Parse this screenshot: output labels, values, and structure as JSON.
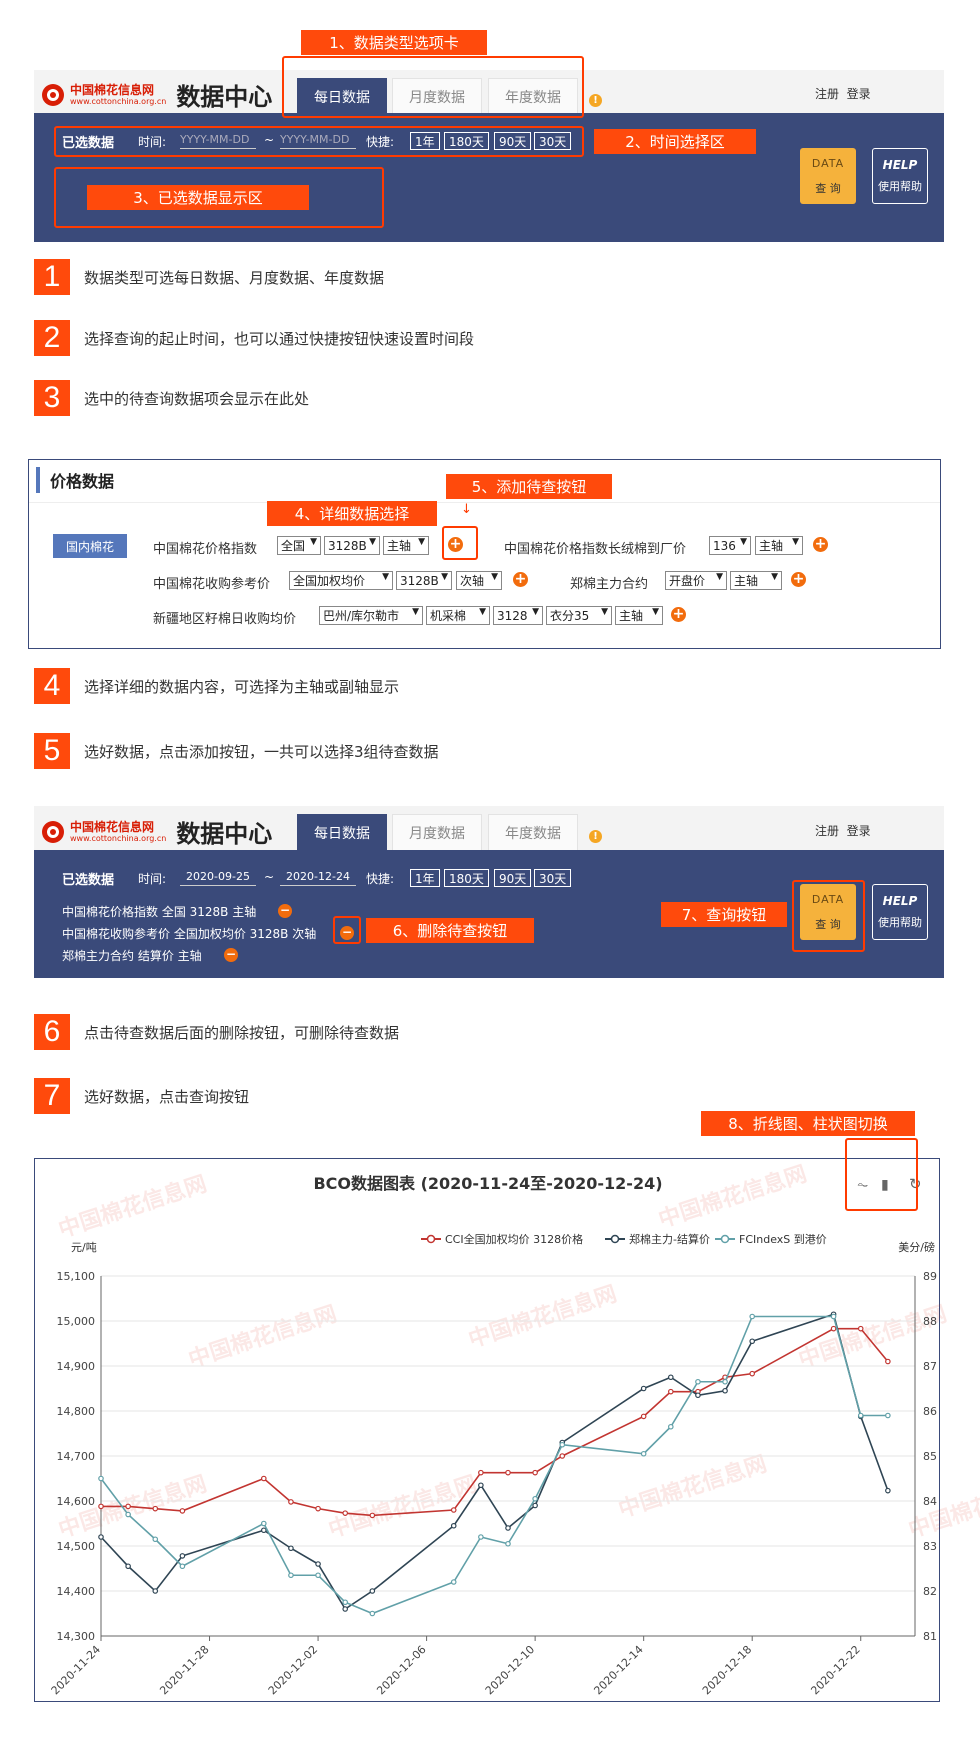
{
  "brand": {
    "name_cn": "中国棉花信息网",
    "url": "www.cottonchina.org.cn",
    "data_center": "数据中心"
  },
  "tabs": [
    "每日数据",
    "月度数据",
    "年度数据"
  ],
  "top_links": {
    "register": "注册",
    "login": "登录"
  },
  "filter": {
    "selected_label": "已选数据",
    "time_label": "时间:",
    "placeholder": "YYYY-MM-DD",
    "tilde": "~",
    "quick_label": "快捷:",
    "quick_options": [
      "1年",
      "180天",
      "90天",
      "30天"
    ]
  },
  "buttons": {
    "data_icon": "DATA",
    "query": "查 询",
    "help_icon": "HELP",
    "help": "使用帮助"
  },
  "callouts": {
    "c1": "1、数据类型选项卡",
    "c2": "2、时间选择区",
    "c3": "3、已选数据显示区",
    "c4": "4、详细数据选择",
    "c5": "5、添加待查按钮",
    "c6": "6、删除待查按钮",
    "c7": "7、查询按钮",
    "c8": "8、折线图、柱状图切换"
  },
  "steps": [
    {
      "num": "1",
      "text": "数据类型可选每日数据、月度数据、年度数据"
    },
    {
      "num": "2",
      "text": "选择查询的起止时间，也可以通过快捷按钮快速设置时间段"
    },
    {
      "num": "3",
      "text": "选中的待查询数据项会显示在此处"
    },
    {
      "num": "4",
      "text": "选择详细的数据内容，可选择为主轴或副轴显示"
    },
    {
      "num": "5",
      "text": "选好数据，点击添加按钮，一共可以选择3组待查数据"
    },
    {
      "num": "6",
      "text": "点击待查数据后面的删除按钮，可删除待查数据"
    },
    {
      "num": "7",
      "text": "选好数据，点击查询按钮"
    }
  ],
  "price": {
    "title": "价格数据",
    "category": "国内棉花",
    "rows": {
      "r1a_label": "中国棉花价格指数",
      "r1a_sel": [
        "全国",
        "3128B",
        "主轴"
      ],
      "r1b_label": "中国棉花价格指数长绒棉到厂价",
      "r1b_sel": [
        "136",
        "主轴"
      ],
      "r2a_label": "中国棉花收购参考价",
      "r2a_sel": [
        "全国加权均价",
        "3128B",
        "次轴"
      ],
      "r2b_label": "郑棉主力合约",
      "r2b_sel": [
        "开盘价",
        "主轴"
      ],
      "r3_label": "新疆地区籽棉日收购均价",
      "r3_sel": [
        "巴州/库尔勒市",
        "机采棉",
        "3128",
        "衣分35",
        "主轴"
      ]
    }
  },
  "second": {
    "date_from": "2020-09-25",
    "date_to": "2020-12-24",
    "selected_items": [
      "中国棉花价格指数 全国 3128B 主轴",
      "中国棉花收购参考价 全国加权均价 3128B 次轴",
      "郑棉主力合约 结算价 主轴"
    ]
  },
  "chart_data": {
    "type": "line",
    "title": "BCO数据图表 (2020-11-24至-2020-12-24)",
    "ylabel_left": "元/吨",
    "ylabel_right": "美分/磅",
    "ylim_left": [
      14300,
      15100
    ],
    "ylim_right": [
      81,
      89
    ],
    "y_ticks_left": [
      "14,300",
      "14,400",
      "14,500",
      "14,600",
      "14,700",
      "14,800",
      "14,900",
      "15,000",
      "15,100"
    ],
    "y_ticks_right": [
      "81",
      "82",
      "83",
      "84",
      "85",
      "86",
      "87",
      "88",
      "89"
    ],
    "x_tick_labels": [
      "2020-11-24",
      "2020-11-28",
      "2020-12-02",
      "2020-12-06",
      "2020-12-10",
      "2020-12-14",
      "2020-12-18",
      "2020-12-22"
    ],
    "legend_position": "top-right",
    "grid": true,
    "series": [
      {
        "name": "CCI全国加权均价 3128价格",
        "color": "#c23531",
        "axis": "left",
        "points": [
          [
            "2020-11-24",
            14588
          ],
          [
            "2020-11-25",
            14588
          ],
          [
            "2020-11-26",
            14583
          ],
          [
            "2020-11-27",
            14578
          ],
          [
            "2020-11-30",
            14650
          ],
          [
            "2020-12-01",
            14598
          ],
          [
            "2020-12-02",
            14583
          ],
          [
            "2020-12-03",
            14573
          ],
          [
            "2020-12-04",
            14568
          ],
          [
            "2020-12-07",
            14580
          ],
          [
            "2020-12-08",
            14663
          ],
          [
            "2020-12-09",
            14663
          ],
          [
            "2020-12-10",
            14663
          ],
          [
            "2020-12-11",
            14700
          ],
          [
            "2020-12-14",
            14788
          ],
          [
            "2020-12-15",
            14843
          ],
          [
            "2020-12-16",
            14843
          ],
          [
            "2020-12-17",
            14875
          ],
          [
            "2020-12-18",
            14883
          ],
          [
            "2020-12-21",
            14983
          ],
          [
            "2020-12-22",
            14983
          ],
          [
            "2020-12-23",
            14910
          ]
        ]
      },
      {
        "name": "郑棉主力-结算价",
        "color": "#2f4554",
        "axis": "left",
        "points": [
          [
            "2020-11-24",
            14520
          ],
          [
            "2020-11-25",
            14455
          ],
          [
            "2020-11-26",
            14400
          ],
          [
            "2020-11-27",
            14478
          ],
          [
            "2020-11-30",
            14535
          ],
          [
            "2020-12-01",
            14495
          ],
          [
            "2020-12-02",
            14460
          ],
          [
            "2020-12-03",
            14360
          ],
          [
            "2020-12-04",
            14400
          ],
          [
            "2020-12-07",
            14545
          ],
          [
            "2020-12-08",
            14635
          ],
          [
            "2020-12-09",
            14540
          ],
          [
            "2020-12-10",
            14590
          ],
          [
            "2020-12-11",
            14730
          ],
          [
            "2020-12-14",
            14850
          ],
          [
            "2020-12-15",
            14875
          ],
          [
            "2020-12-16",
            14835
          ],
          [
            "2020-12-17",
            14845
          ],
          [
            "2020-12-18",
            14955
          ],
          [
            "2020-12-21",
            15015
          ],
          [
            "2020-12-22",
            14788
          ],
          [
            "2020-12-23",
            14623
          ]
        ]
      },
      {
        "name": "FCIndexS 到港价",
        "color": "#61a0a8",
        "axis": "right",
        "points": [
          [
            "2020-11-24",
            84.5
          ],
          [
            "2020-11-25",
            83.7
          ],
          [
            "2020-11-26",
            83.15
          ],
          [
            "2020-11-27",
            82.55
          ],
          [
            "2020-11-30",
            83.5
          ],
          [
            "2020-12-01",
            82.35
          ],
          [
            "2020-12-02",
            82.35
          ],
          [
            "2020-12-03",
            81.75
          ],
          [
            "2020-12-04",
            81.5
          ],
          [
            "2020-12-07",
            82.2
          ],
          [
            "2020-12-08",
            83.2
          ],
          [
            "2020-12-09",
            83.05
          ],
          [
            "2020-12-10",
            84.05
          ],
          [
            "2020-12-11",
            85.25
          ],
          [
            "2020-12-14",
            85.05
          ],
          [
            "2020-12-15",
            85.65
          ],
          [
            "2020-12-16",
            86.65
          ],
          [
            "2020-12-17",
            86.65
          ],
          [
            "2020-12-18",
            88.1
          ],
          [
            "2020-12-21",
            88.1
          ],
          [
            "2020-12-22",
            85.9
          ],
          [
            "2020-12-23",
            85.9
          ]
        ]
      }
    ]
  },
  "watermark": {
    "cn": "中国棉花信息网",
    "url": "www.cottonchina.org.cn"
  }
}
